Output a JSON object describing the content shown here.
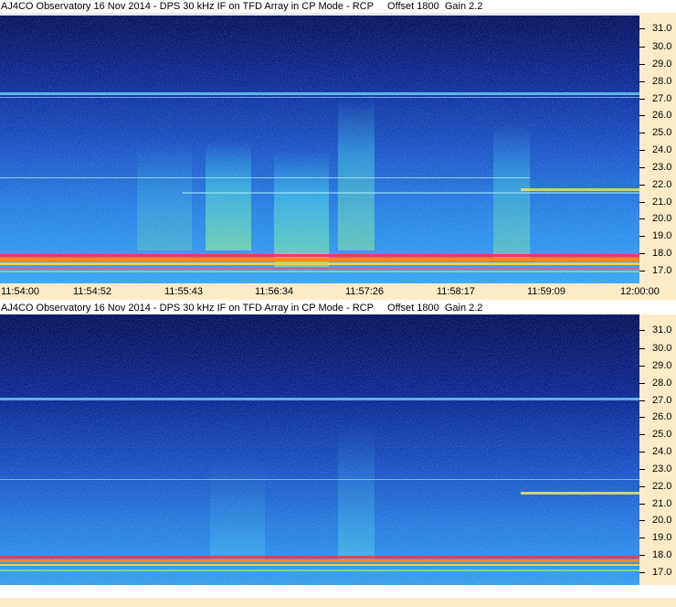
{
  "panels": [
    {
      "title": "AJ4CO Observatory 16 Nov 2014 - DPS 30 kHz IF on TFD Array in CP Mode - RCP     Offset 1800  Gain 2.2"
    },
    {
      "title": "AJ4CO Observatory 16 Nov 2014 - DPS 30 kHz IF on TFD Array in CP Mode - RCP     Offset 1800  Gain 2.2"
    }
  ],
  "freq_labels": [
    "31.0",
    "30.0",
    "29.0",
    "28.0",
    "27.0",
    "26.0",
    "25.0",
    "24.0",
    "23.0",
    "22.0",
    "21.0",
    "20.0",
    "19.0",
    "18.0",
    "17.0"
  ],
  "time_labels": [
    "11:54:00",
    "11:54:52",
    "11:55:43",
    "11:56:34",
    "11:57:26",
    "11:58:17",
    "11:59:09",
    "12:00:00"
  ],
  "colors": {
    "axis_bg": "#fdebc8",
    "spectro_dark": "#0a1a6e",
    "spectro_mid": "#1e5fd0",
    "spectro_light": "#3fb0f0"
  }
}
